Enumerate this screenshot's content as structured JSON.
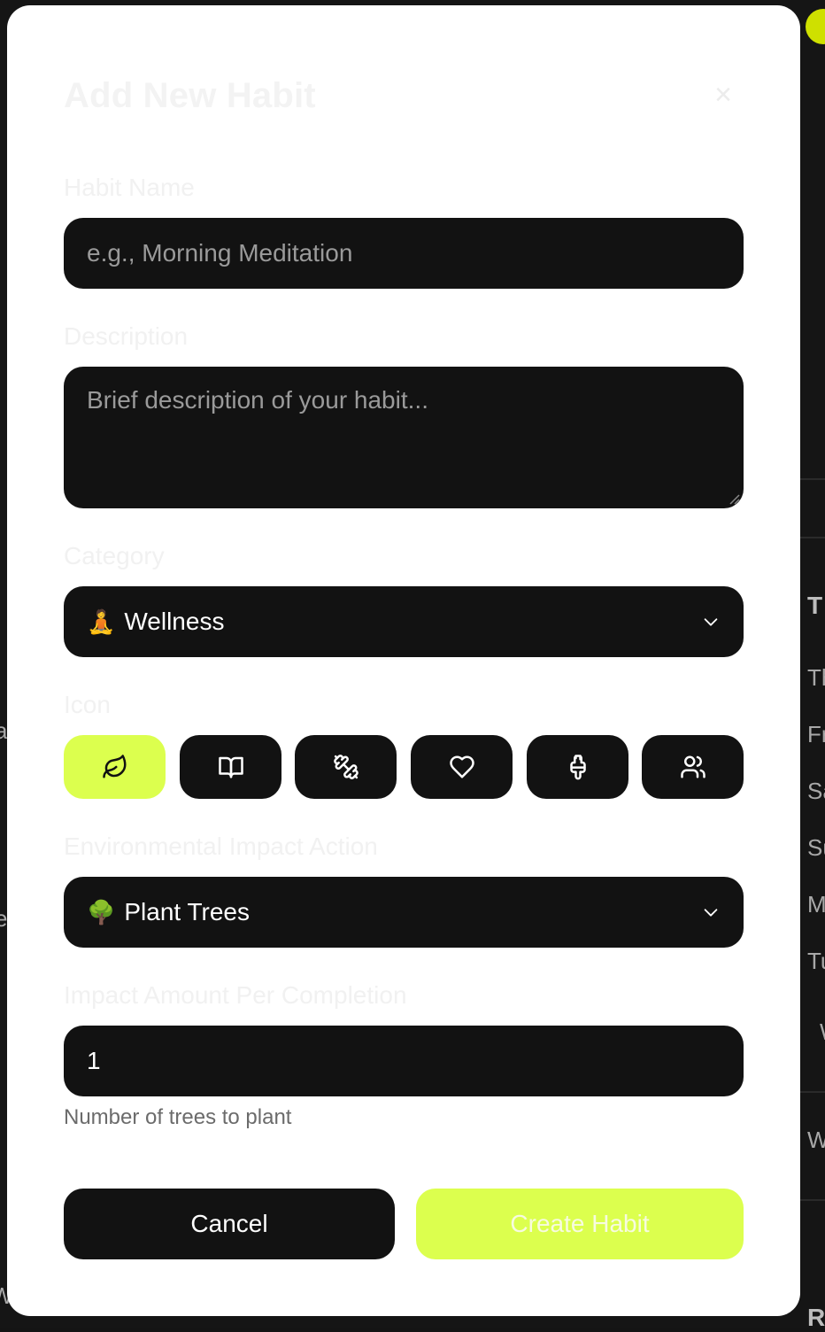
{
  "modal": {
    "title": "Add New Habit",
    "close_icon": "close-icon"
  },
  "form": {
    "name_label": "Habit Name",
    "name_placeholder": "e.g., Morning Meditation",
    "description_label": "Description",
    "description_placeholder": "Brief description of your habit...",
    "category_label": "Category",
    "category_emoji": "🧘",
    "category_value": "Wellness",
    "icon_label": "Icon",
    "icons": [
      {
        "name": "leaf-icon",
        "selected": true
      },
      {
        "name": "book-icon",
        "selected": false
      },
      {
        "name": "dumbbell-icon",
        "selected": false
      },
      {
        "name": "heart-icon",
        "selected": false
      },
      {
        "name": "paintbrush-icon",
        "selected": false
      },
      {
        "name": "users-icon",
        "selected": false
      }
    ],
    "impact_label": "Environmental Impact Action",
    "impact_emoji": "🌳",
    "impact_value": "Plant Trees",
    "amount_label": "Impact Amount Per Completion",
    "amount_value": "1",
    "amount_helper": "Number of trees to plant",
    "cancel_label": "Cancel",
    "create_label": "Create Habit"
  },
  "colors": {
    "accent": "#dcff4e",
    "field_bg": "#121212",
    "modal_bg": "#ffffff"
  },
  "background": {
    "right_letters": [
      "T",
      "Th",
      "Fr",
      "Sa",
      "Su",
      "M",
      "Tu",
      "W",
      "W",
      "R"
    ],
    "left_letters": [
      "a",
      "e",
      "W"
    ]
  }
}
